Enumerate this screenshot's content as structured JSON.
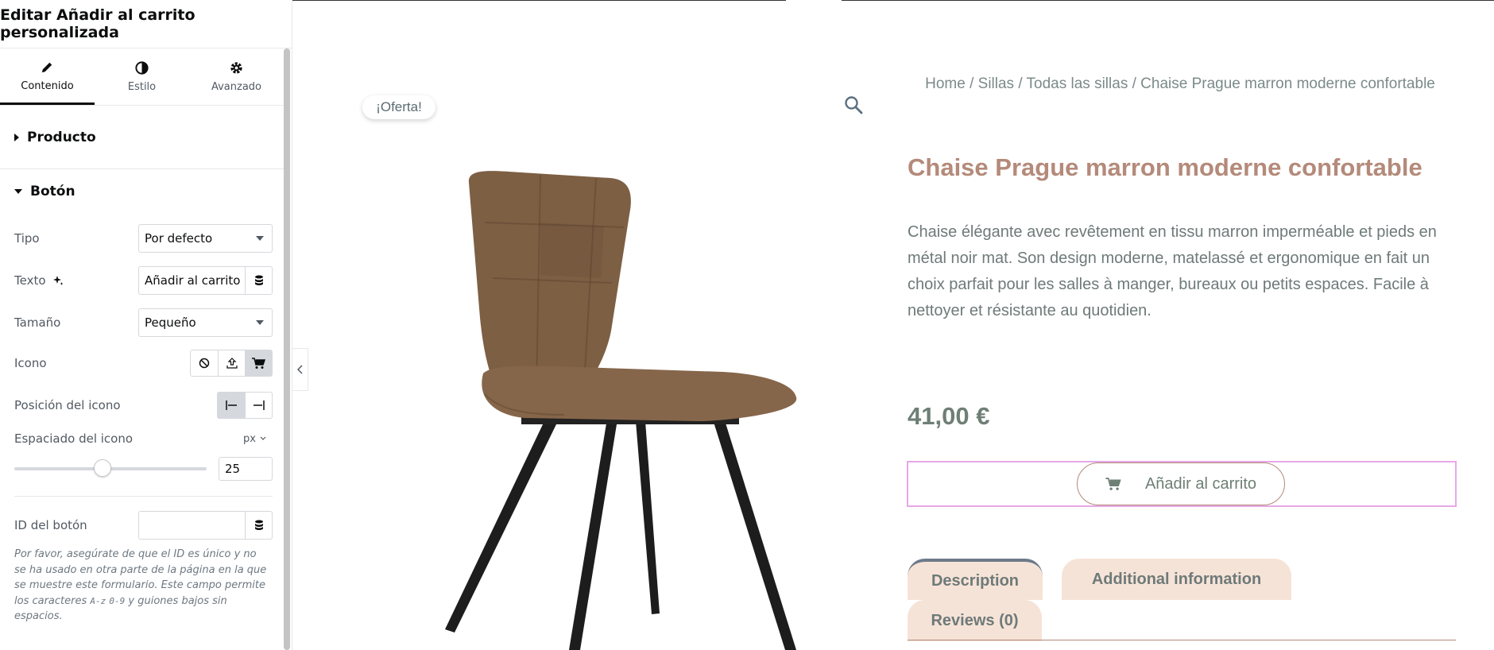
{
  "panel": {
    "title": "Editar Añadir al carrito personalizada",
    "tabs": [
      {
        "label": "Contenido",
        "icon": "pencil-icon",
        "active": true
      },
      {
        "label": "Estilo",
        "icon": "contrast-icon",
        "active": false
      },
      {
        "label": "Avanzado",
        "icon": "gear-icon",
        "active": false
      }
    ],
    "sections": {
      "producto": "Producto",
      "boton": "Botón"
    },
    "fields": {
      "tipo_label": "Tipo",
      "tipo_value": "Por defecto",
      "texto_label": "Texto",
      "texto_value": "Añadir al carrito",
      "tamano_label": "Tamaño",
      "tamano_value": "Pequeño",
      "icono_label": "Icono",
      "icono_selected": "cart-icon",
      "posicion_label": "Posición del icono",
      "posicion_selected": "before",
      "espaciado_label": "Espaciado del icono",
      "espaciado_unit": "px",
      "espaciado_value": "25",
      "espaciado_percent": 46,
      "id_label": "ID del botón",
      "id_value": ""
    },
    "help_text_1": "Por favor, asegúrate de que el ID es único y no se ha usado en otra parte de la página en la que se muestre este formulario. Este campo permite los caracteres ",
    "help_code_1": "A-z",
    "help_code_2": "0-9",
    "help_text_2": " y guiones bajos sin espacios."
  },
  "product": {
    "badge": "¡Oferta!",
    "breadcrumb": "Home / Sillas / Todas las sillas / Chaise Prague marron moderne confortable",
    "title": "Chaise Prague marron moderne confortable",
    "description": "Chaise élégante avec revêtement en tissu marron imperméable et pieds en métal noir mat. Son design moderne, matelassé et ergonomique en fait un choix parfait pour les salles à manger, bureaux ou petits espaces. Facile à nettoyer et résistante au quotidien.",
    "price": "41,00 €",
    "add_to_cart": "Añadir al carrito",
    "tabs": [
      "Description",
      "Additional information",
      "Reviews (0)"
    ]
  },
  "colors": {
    "accent_title": "#b48a7a",
    "tab_bg": "#f6e3d7",
    "text_muted": "#6e7a79",
    "selection_frame": "#e8a8e8"
  }
}
